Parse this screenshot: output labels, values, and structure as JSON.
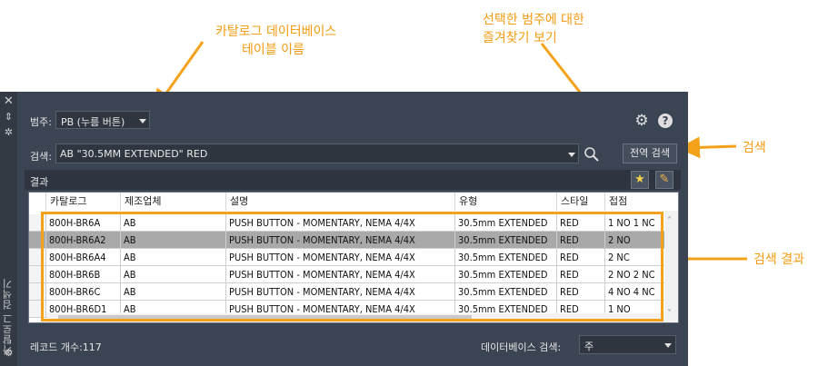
{
  "annotations": {
    "table_name": [
      "카탈로그 데이터베이스",
      "테이블 이름"
    ],
    "favorites": [
      "선택한 범주에 대한",
      "즐겨찾기 보기"
    ],
    "search": "검색",
    "results": "검색 결과"
  },
  "palette_title": "카탈로그 검색기",
  "category": {
    "label": "범주:",
    "value": "PB (누름 버튼)"
  },
  "search": {
    "label": "검색:",
    "value": "AB \"30.5MM EXTENDED\" RED",
    "global_button": "전역 검색"
  },
  "results_header": "결과",
  "table": {
    "columns": [
      "카탈로그",
      "제조업체",
      "설명",
      "유형",
      "스타일",
      "접점"
    ],
    "rows": [
      [
        "800H-BR6A",
        "AB",
        "PUSH BUTTON - MOMENTARY, NEMA 4/4X",
        "30.5mm EXTENDED",
        "RED",
        "1 NO 1 NC"
      ],
      [
        "800H-BR6A2",
        "AB",
        "PUSH BUTTON - MOMENTARY, NEMA 4/4X",
        "30.5mm EXTENDED",
        "RED",
        "2 NO"
      ],
      [
        "800H-BR6A4",
        "AB",
        "PUSH BUTTON - MOMENTARY, NEMA 4/4X",
        "30.5mm EXTENDED",
        "RED",
        "2 NC"
      ],
      [
        "800H-BR6B",
        "AB",
        "PUSH BUTTON - MOMENTARY, NEMA 4/4X",
        "30.5mm EXTENDED",
        "RED",
        "2 NO 2 NC"
      ],
      [
        "800H-BR6C",
        "AB",
        "PUSH BUTTON - MOMENTARY, NEMA 4/4X",
        "30.5mm EXTENDED",
        "RED",
        "4 NO 4 NC"
      ],
      [
        "800H-BR6D1",
        "AB",
        "PUSH BUTTON - MOMENTARY, NEMA 4/4X",
        "30.5mm EXTENDED",
        "RED",
        "1 NO"
      ]
    ],
    "selected_row": 1
  },
  "record_count": "레코드 개수:117",
  "db_search": {
    "label": "데이터베이스 검색:",
    "value": "주"
  },
  "colors": {
    "annotation": "#f5a21b",
    "panel": "#3b4453",
    "selected_row": "#a9a9a9"
  }
}
